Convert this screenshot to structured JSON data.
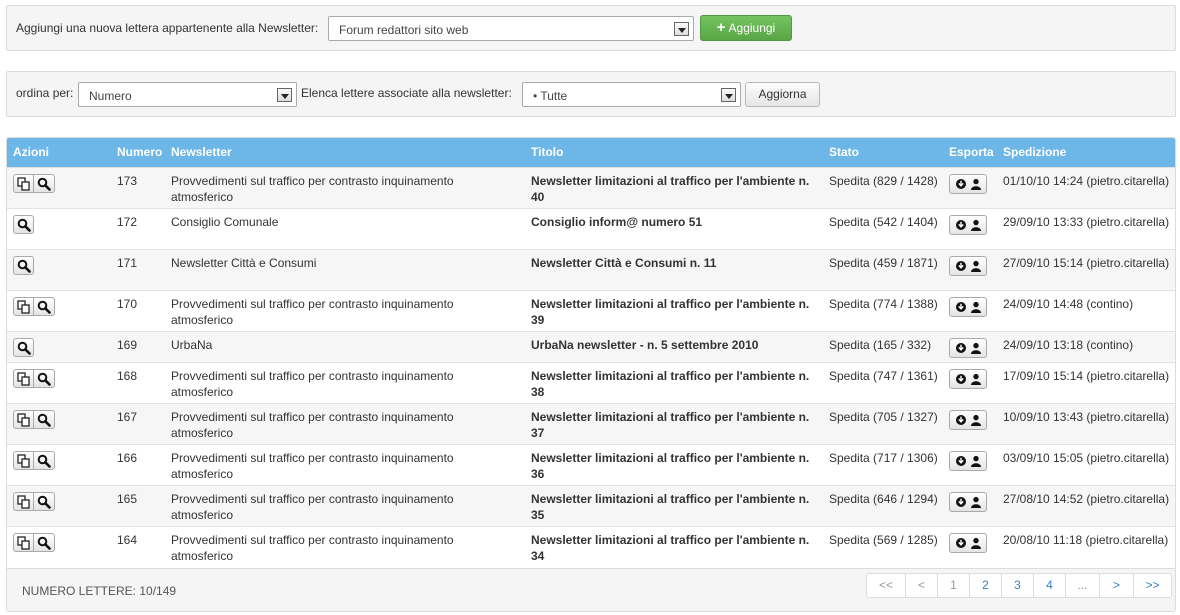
{
  "add_bar": {
    "label": "Aggiungi una nuova lettera appartenente alla Newsletter:",
    "newsletter_select": "Forum redattori sito web",
    "add_button": "Aggiungi"
  },
  "filter_bar": {
    "order_label": "ordina per:",
    "order_select": "Numero",
    "list_label": "Elenca lettere associate alla newsletter:",
    "list_select": "• Tutte",
    "refresh_button": "Aggiorna"
  },
  "table": {
    "headers": {
      "azioni": "Azioni",
      "numero": "Numero",
      "newsletter": "Newsletter",
      "titolo": "Titolo",
      "stato": "Stato",
      "esporta": "Esporta",
      "spedizione": "Spedizione"
    },
    "rows": [
      {
        "numero": "173",
        "newsletter": "Provvedimenti sul traffico per contrasto inquinamento atmosferico",
        "titolo": "Newsletter limitazioni al traffico per l'ambiente n. 40",
        "stato": "Spedita (829 / 1428)",
        "spedizione": "01/10/10 14:24 (pietro.citarella)"
      },
      {
        "numero": "172",
        "newsletter": "Consiglio Comunale",
        "titolo": "Consiglio inform@ numero 51",
        "stato": "Spedita (542 / 1404)",
        "spedizione": "29/09/10 13:33 (pietro.citarella)"
      },
      {
        "numero": "171",
        "newsletter": "Newsletter Città e Consumi",
        "titolo": "Newsletter Città e Consumi n. 11",
        "stato": "Spedita (459 / 1871)",
        "spedizione": "27/09/10 15:14 (pietro.citarella)"
      },
      {
        "numero": "170",
        "newsletter": "Provvedimenti sul traffico per contrasto inquinamento atmosferico",
        "titolo": "Newsletter limitazioni al traffico per l'ambiente n. 39",
        "stato": "Spedita (774 / 1388)",
        "spedizione": "24/09/10 14:48 (contino)"
      },
      {
        "numero": "169",
        "newsletter": "UrbaNa",
        "titolo": "UrbaNa newsletter - n. 5 settembre 2010",
        "stato": "Spedita (165 / 332)",
        "spedizione": "24/09/10 13:18 (contino)"
      },
      {
        "numero": "168",
        "newsletter": "Provvedimenti sul traffico per contrasto inquinamento atmosferico",
        "titolo": "Newsletter limitazioni al traffico per l'ambiente n. 38",
        "stato": "Spedita (747 / 1361)",
        "spedizione": "17/09/10 15:14 (pietro.citarella)"
      },
      {
        "numero": "167",
        "newsletter": "Provvedimenti sul traffico per contrasto inquinamento atmosferico",
        "titolo": "Newsletter limitazioni al traffico per l'ambiente n. 37",
        "stato": "Spedita (705 / 1327)",
        "spedizione": "10/09/10 13:43 (pietro.citarella)"
      },
      {
        "numero": "166",
        "newsletter": "Provvedimenti sul traffico per contrasto inquinamento atmosferico",
        "titolo": "Newsletter limitazioni al traffico per l'ambiente n. 36",
        "stato": "Spedita (717 / 1306)",
        "spedizione": "03/09/10 15:05 (pietro.citarella)"
      },
      {
        "numero": "165",
        "newsletter": "Provvedimenti sul traffico per contrasto inquinamento atmosferico",
        "titolo": "Newsletter limitazioni al traffico per l'ambiente n. 35",
        "stato": "Spedita (646 / 1294)",
        "spedizione": "27/08/10 14:52 (pietro.citarella)"
      },
      {
        "numero": "164",
        "newsletter": "Provvedimenti sul traffico per contrasto inquinamento atmosferico",
        "titolo": "Newsletter limitazioni al traffico per l'ambiente n. 34",
        "stato": "Spedita (569 / 1285)",
        "spedizione": "20/08/10 11:18 (pietro.citarella)"
      }
    ],
    "footer_count": "NUMERO LETTERE: 10/149"
  },
  "pagination": {
    "items": [
      "<<",
      "<",
      "1",
      "2",
      "3",
      "4",
      "...",
      ">",
      ">>"
    ]
  },
  "colors": {
    "header_blue": "#6cb6e8",
    "add_green": "#5aa647",
    "link_blue": "#3a7fc1"
  },
  "icons": {
    "duplicate": "copy-icon",
    "view": "search-icon",
    "export_download": "download-icon",
    "export_user": "user-icon"
  }
}
